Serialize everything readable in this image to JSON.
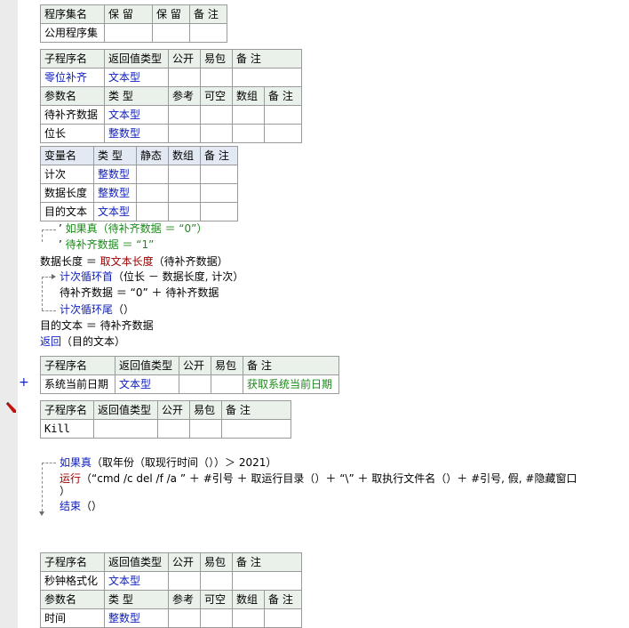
{
  "assembly_table": {
    "headers": [
      "程序集名",
      "保 留",
      "保 留",
      "备 注"
    ],
    "row": [
      "公用程序集",
      "",
      "",
      ""
    ]
  },
  "sub1": {
    "headers": [
      "子程序名",
      "返回值类型",
      "公开",
      "易包",
      "备 注"
    ],
    "row": [
      "零位补齐",
      "文本型",
      "",
      "",
      ""
    ],
    "param_headers": [
      "参数名",
      "类 型",
      "参考",
      "可空",
      "数组",
      "备 注"
    ],
    "params": [
      [
        "待补齐数据",
        "文本型",
        "",
        "",
        "",
        ""
      ],
      [
        "位长",
        "整数型",
        "",
        "",
        "",
        ""
      ]
    ]
  },
  "vars": {
    "headers": [
      "变量名",
      "类 型",
      "静态",
      "数组",
      "备 注"
    ],
    "rows": [
      [
        "计次",
        "整数型",
        "",
        "",
        ""
      ],
      [
        "数据长度",
        "整数型",
        "",
        "",
        ""
      ],
      [
        "目的文本",
        "文本型",
        "",
        "",
        ""
      ]
    ]
  },
  "code1": {
    "if_cmd": "如果真",
    "if_cond": "（待补齐数据 ＝ “0”）",
    "if_body": "待补齐数据 ＝ “1”",
    "len_var": "数据长度 ＝ ",
    "len_func": "取文本长度",
    "len_arg": "（待补齐数据）",
    "loop_cmd": "计次循环首",
    "loop_args": "（位长 － 数据长度, 计次）",
    "loop_body": "待补齐数据 ＝ “0” ＋ 待补齐数据",
    "loop_end_cmd": "计次循环尾",
    "loop_end_args": "（）",
    "assign": "目的文本 ＝ 待补齐数据",
    "return_cmd": "返回",
    "return_args": "（目的文本）"
  },
  "sub2": {
    "headers": [
      "子程序名",
      "返回值类型",
      "公开",
      "易包",
      "备 注"
    ],
    "row": [
      "系统当前日期",
      "文本型",
      "",
      "",
      "获取系统当前日期"
    ]
  },
  "sub3": {
    "headers": [
      "子程序名",
      "返回值类型",
      "公开",
      "易包",
      "备 注"
    ],
    "row": [
      "Kill",
      "",
      "",
      "",
      ""
    ]
  },
  "code2": {
    "if_cmd": "如果真",
    "if_cond": "（取年份（取现行时间（））＞ 2021）",
    "run_cmd": "运行",
    "run_args": "（“cmd /c del /f /a ” ＋ #引号 ＋ 取运行目录（）＋ “\\” ＋ 取执行文件名（）＋ #引号, 假, #隐藏窗口",
    "run_close": "）",
    "end_cmd": "结束",
    "end_args": "（）"
  },
  "sub4": {
    "headers": [
      "子程序名",
      "返回值类型",
      "公开",
      "易包",
      "备 注"
    ],
    "row": [
      "秒钟格式化",
      "文本型",
      "",
      "",
      ""
    ],
    "param_headers": [
      "参数名",
      "类 型",
      "参考",
      "可空",
      "数组",
      "备 注"
    ],
    "params": [
      [
        "时间",
        "整数型",
        "",
        "",
        "",
        ""
      ]
    ]
  },
  "colors": {
    "keyword": "#1020c0",
    "type": "#1020c0",
    "comment": "#1a8a1a",
    "func": "#a00000"
  },
  "icons": [
    "plus-icon",
    "pencil-icon"
  ]
}
